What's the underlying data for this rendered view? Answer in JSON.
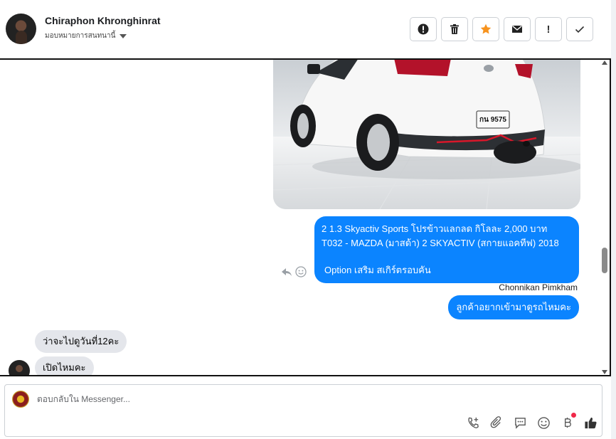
{
  "header": {
    "contact_name": "Chiraphon Khronghinrat",
    "assign_label": "มอบหมายการสนทนานี้",
    "actions": [
      {
        "name": "spam-button",
        "icon": "alert-circle-icon",
        "glyph": "!"
      },
      {
        "name": "delete-button",
        "icon": "trash-icon",
        "glyph": ""
      },
      {
        "name": "star-button",
        "icon": "star-icon",
        "glyph": ""
      },
      {
        "name": "mark-unread-button",
        "icon": "envelope-icon",
        "glyph": ""
      },
      {
        "name": "follow-up-button",
        "icon": "exclamation-icon",
        "glyph": "!"
      },
      {
        "name": "done-button",
        "icon": "check-icon",
        "glyph": ""
      }
    ]
  },
  "thread": {
    "image": {
      "plate_text": "กน 9575"
    },
    "messages": [
      {
        "direction": "out",
        "lines": [
          "2 1.3 Skyactiv Sports โปรข้าวแลกลด กิโลละ 2,000 บาท",
          "T032 - MAZDA (มาสด้า) 2 SKYACTIV (สกายแอคทีฟ) 2018",
          "",
          " Option เสริม สเกิร์ตรอบคัน"
        ]
      },
      {
        "direction": "out",
        "text": "ลูกค้าอยากเข้ามาดูรถไหมคะ"
      },
      {
        "direction": "in",
        "text": "ว่าจะไปดูวันที่12คะ"
      },
      {
        "direction": "in",
        "text": "เปิดไหมคะ"
      }
    ],
    "sender_label": "Chonnikan Pimkham"
  },
  "composer": {
    "placeholder": "ตอบกลับใน Messenger...",
    "tools": [
      "call-icon",
      "attachment-icon",
      "saved-replies-icon",
      "emoji-icon",
      "baht-payment-icon",
      "like-icon"
    ]
  },
  "colors": {
    "outgoing_bubble": "#0b84ff",
    "incoming_bubble": "#e4e6eb",
    "star": "#f7931e",
    "notification_dot": "#f02849"
  }
}
